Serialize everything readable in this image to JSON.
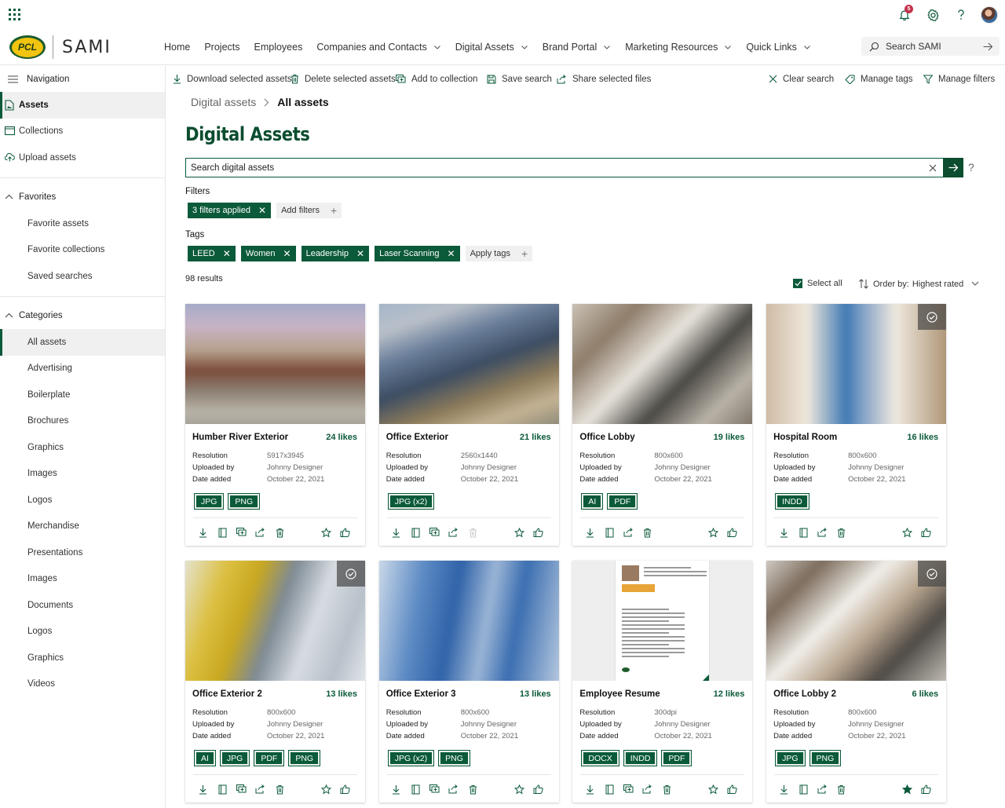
{
  "app": {
    "brand": "SAMI",
    "logo_text": "PCL",
    "notification_count": "5"
  },
  "nav": [
    {
      "label": "Home",
      "dropdown": false
    },
    {
      "label": "Projects",
      "dropdown": false
    },
    {
      "label": "Employees",
      "dropdown": false
    },
    {
      "label": "Companies and Contacts",
      "dropdown": true
    },
    {
      "label": "Digital Assets",
      "dropdown": true
    },
    {
      "label": "Brand Portal",
      "dropdown": true
    },
    {
      "label": "Marketing Resources",
      "dropdown": true
    },
    {
      "label": "Quick Links",
      "dropdown": true
    }
  ],
  "top_search": {
    "placeholder": "Search SAMI"
  },
  "sidebar": {
    "heading": "Navigation",
    "top_items": [
      {
        "label": "Assets",
        "icon": "asset-icon",
        "active": true
      },
      {
        "label": "Collections",
        "icon": "collection-icon",
        "active": false
      },
      {
        "label": "Upload assets",
        "icon": "upload-icon",
        "active": false
      }
    ],
    "favorites": {
      "label": "Favorites",
      "items": [
        "Favorite assets",
        "Favorite collections",
        "Saved searches"
      ]
    },
    "categories": {
      "label": "Categories",
      "items": [
        "All assets",
        "Advertising",
        "Boilerplate",
        "Brochures",
        "Graphics",
        "Images",
        "Logos",
        "Merchandise",
        "Presentations",
        "Images",
        "Documents",
        "Logos",
        "Graphics",
        "Videos"
      ],
      "active_index": 0
    }
  },
  "commands": {
    "download": "Download selected assets",
    "delete": "Delete selected assets",
    "add_to_collection": "Add to collection",
    "save_search": "Save search",
    "share": "Share selected files",
    "clear_search": "Clear search",
    "manage_tags": "Manage tags",
    "manage_filters": "Manage filters"
  },
  "breadcrumb": {
    "parent": "Digital assets",
    "current": "All assets"
  },
  "page_title": "Digital Assets",
  "asset_search": {
    "placeholder": "Search digital assets",
    "help": "?"
  },
  "filters": {
    "label": "Filters",
    "applied": "3 filters applied",
    "add": "Add filters"
  },
  "tags": {
    "label": "Tags",
    "items": [
      "LEED",
      "Women",
      "Leadership",
      "Laser Scanning"
    ],
    "apply": "Apply tags"
  },
  "results": {
    "count_text": "98 results",
    "select_all": "Select all",
    "order_label": "Order by:",
    "order_value": "Highest rated"
  },
  "meta_labels": {
    "resolution": "Resolution",
    "uploaded_by": "Uploaded by",
    "date_added": "Date added"
  },
  "colors": {
    "brand_green": "#0b5a3a",
    "title_green": "#0b4d2f",
    "badge_red": "#c4314b"
  },
  "assets": [
    {
      "title": "Humber River Exterior",
      "likes": "24 likes",
      "resolution": "5917x3945",
      "uploaded_by": "Johnny Designer",
      "date_added": "October 22, 2021",
      "formats": [
        "JPG",
        "PNG"
      ],
      "selected": false,
      "favorited": false,
      "image": "building-exterior",
      "actions": [
        "download",
        "copy",
        "collection",
        "share",
        "delete"
      ]
    },
    {
      "title": "Office Exterior",
      "likes": "21 likes",
      "resolution": "2560x1440",
      "uploaded_by": "Johnny Designer",
      "date_added": "October 22, 2021",
      "formats": [
        "JPG (x2)"
      ],
      "selected": false,
      "favorited": false,
      "image": "office-exterior",
      "actions": [
        "download",
        "copy",
        "collection",
        "share",
        "delete-disabled"
      ]
    },
    {
      "title": "Office Lobby",
      "likes": "19 likes",
      "resolution": "800x600",
      "uploaded_by": "Johnny Designer",
      "date_added": "October 22, 2021",
      "formats": [
        "AI",
        "PDF"
      ],
      "selected": false,
      "favorited": false,
      "image": "lobby",
      "actions": [
        "download",
        "copy",
        "share",
        "delete"
      ]
    },
    {
      "title": "Hospital Room",
      "likes": "16 likes",
      "resolution": "800x600",
      "uploaded_by": "Johnny Designer",
      "date_added": "October 22, 2021",
      "formats": [
        "INDD"
      ],
      "selected": true,
      "favorited": false,
      "image": "hospital",
      "actions": [
        "download",
        "copy",
        "share",
        "delete"
      ]
    },
    {
      "title": "Office Exterior 2",
      "likes": "13 likes",
      "resolution": "800x600",
      "uploaded_by": "Johnny Designer",
      "date_added": "October 22, 2021",
      "formats": [
        "AI",
        "JPG",
        "PDF",
        "PNG"
      ],
      "selected": true,
      "favorited": false,
      "image": "yellow-tower",
      "actions": [
        "download",
        "copy",
        "collection",
        "share",
        "delete"
      ]
    },
    {
      "title": "Office Exterior 3",
      "likes": "13 likes",
      "resolution": "800x600",
      "uploaded_by": "Johnny Designer",
      "date_added": "October 22, 2021",
      "formats": [
        "JPG (x2)",
        "PNG"
      ],
      "selected": false,
      "favorited": false,
      "image": "blue-tower",
      "actions": [
        "download",
        "copy",
        "collection",
        "share",
        "delete"
      ]
    },
    {
      "title": "Employee Resume",
      "likes": "12 likes",
      "resolution": "300dpi",
      "uploaded_by": "Johnny Designer",
      "date_added": "October 22, 2021",
      "formats": [
        "DOCX",
        "INDD",
        "PDF"
      ],
      "selected": false,
      "favorited": false,
      "image": "document",
      "actions": [
        "download",
        "copy",
        "collection",
        "share",
        "delete"
      ]
    },
    {
      "title": "Office Lobby 2",
      "likes": "6 likes",
      "resolution": "800x600",
      "uploaded_by": "Johnny Designer",
      "date_added": "October 22, 2021",
      "formats": [
        "JPG",
        "PNG"
      ],
      "selected": true,
      "favorited": true,
      "image": "lobby-2",
      "actions": [
        "download",
        "copy",
        "share",
        "delete"
      ]
    }
  ]
}
